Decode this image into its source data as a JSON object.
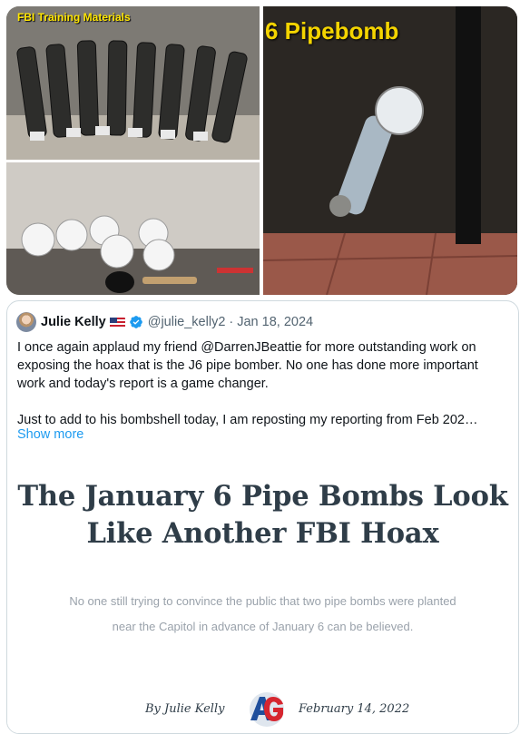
{
  "media": {
    "top_left_label": "FBI Training Materials",
    "right_label": "6 Pipebomb"
  },
  "quoted_tweet": {
    "author_name": "Julie Kelly",
    "flag_emoji": "us-flag-icon",
    "verified": true,
    "handle": "@julie_kelly2",
    "separator": "·",
    "date": "Jan 18, 2024",
    "paragraph_1": "I once again applaud my friend @DarrenJBeattie for more outstanding work on exposing the hoax that is the J6 pipe bomber. No one has done more important work and today's report is a game changer.",
    "paragraph_2": "Just to add to his bombshell today, I am reposting my reporting from Feb 202…",
    "show_more": "Show more"
  },
  "article_card": {
    "title": "The January 6 Pipe Bombs Look Like Another FBI Hoax",
    "subtitle": "No one still trying to convince the public that two pipe bombs were planted near the Capitol in advance of January 6 can be believed.",
    "byline_author": "By Julie Kelly",
    "byline_date": "February 14, 2022",
    "logo_letters": "AG"
  },
  "colors": {
    "link_blue": "#1d9bf0",
    "text_dark": "#0f1419",
    "text_muted": "#536471",
    "border": "#cfd9de",
    "title_slate": "#2f3d48",
    "label_yellow": "#ffe600"
  }
}
